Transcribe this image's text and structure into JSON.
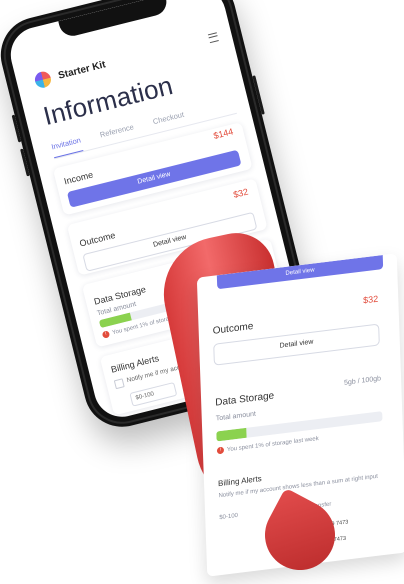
{
  "app": {
    "name": "Starter Kit",
    "page_title": "Information"
  },
  "tabs": [
    {
      "label": "Invitation",
      "active": true
    },
    {
      "label": "Reference",
      "active": false
    },
    {
      "label": "Checkout",
      "active": false
    }
  ],
  "income": {
    "label": "Income",
    "amount": "$144",
    "button": "Detail view"
  },
  "outcome": {
    "label": "Outcome",
    "amount": "$32",
    "button": "Detail view"
  },
  "storage": {
    "label": "Data Storage",
    "usage": "5gb / 100gb",
    "sub_label": "Total amount",
    "warning": "You spent 1% of storage last week",
    "progress_pct": 18
  },
  "billing": {
    "label": "Billing Alerts",
    "notify_text": "Notify me if my account shows less than a sum at right input",
    "range_placeholder": "$0-100",
    "card_mode": "Transfer",
    "visa_number": "4657 3747 9959 7473",
    "mc_number": "4657 3747 9959 7473"
  },
  "colors": {
    "accent": "#6f74e8",
    "amount_red": "#e24c3c",
    "progress_green": "#8bd24f",
    "paper_red": "#e24c4c"
  },
  "icons": {
    "logo": "starter-kit-logo",
    "menu": "hamburger-menu-icon",
    "warning": "warning-icon"
  }
}
